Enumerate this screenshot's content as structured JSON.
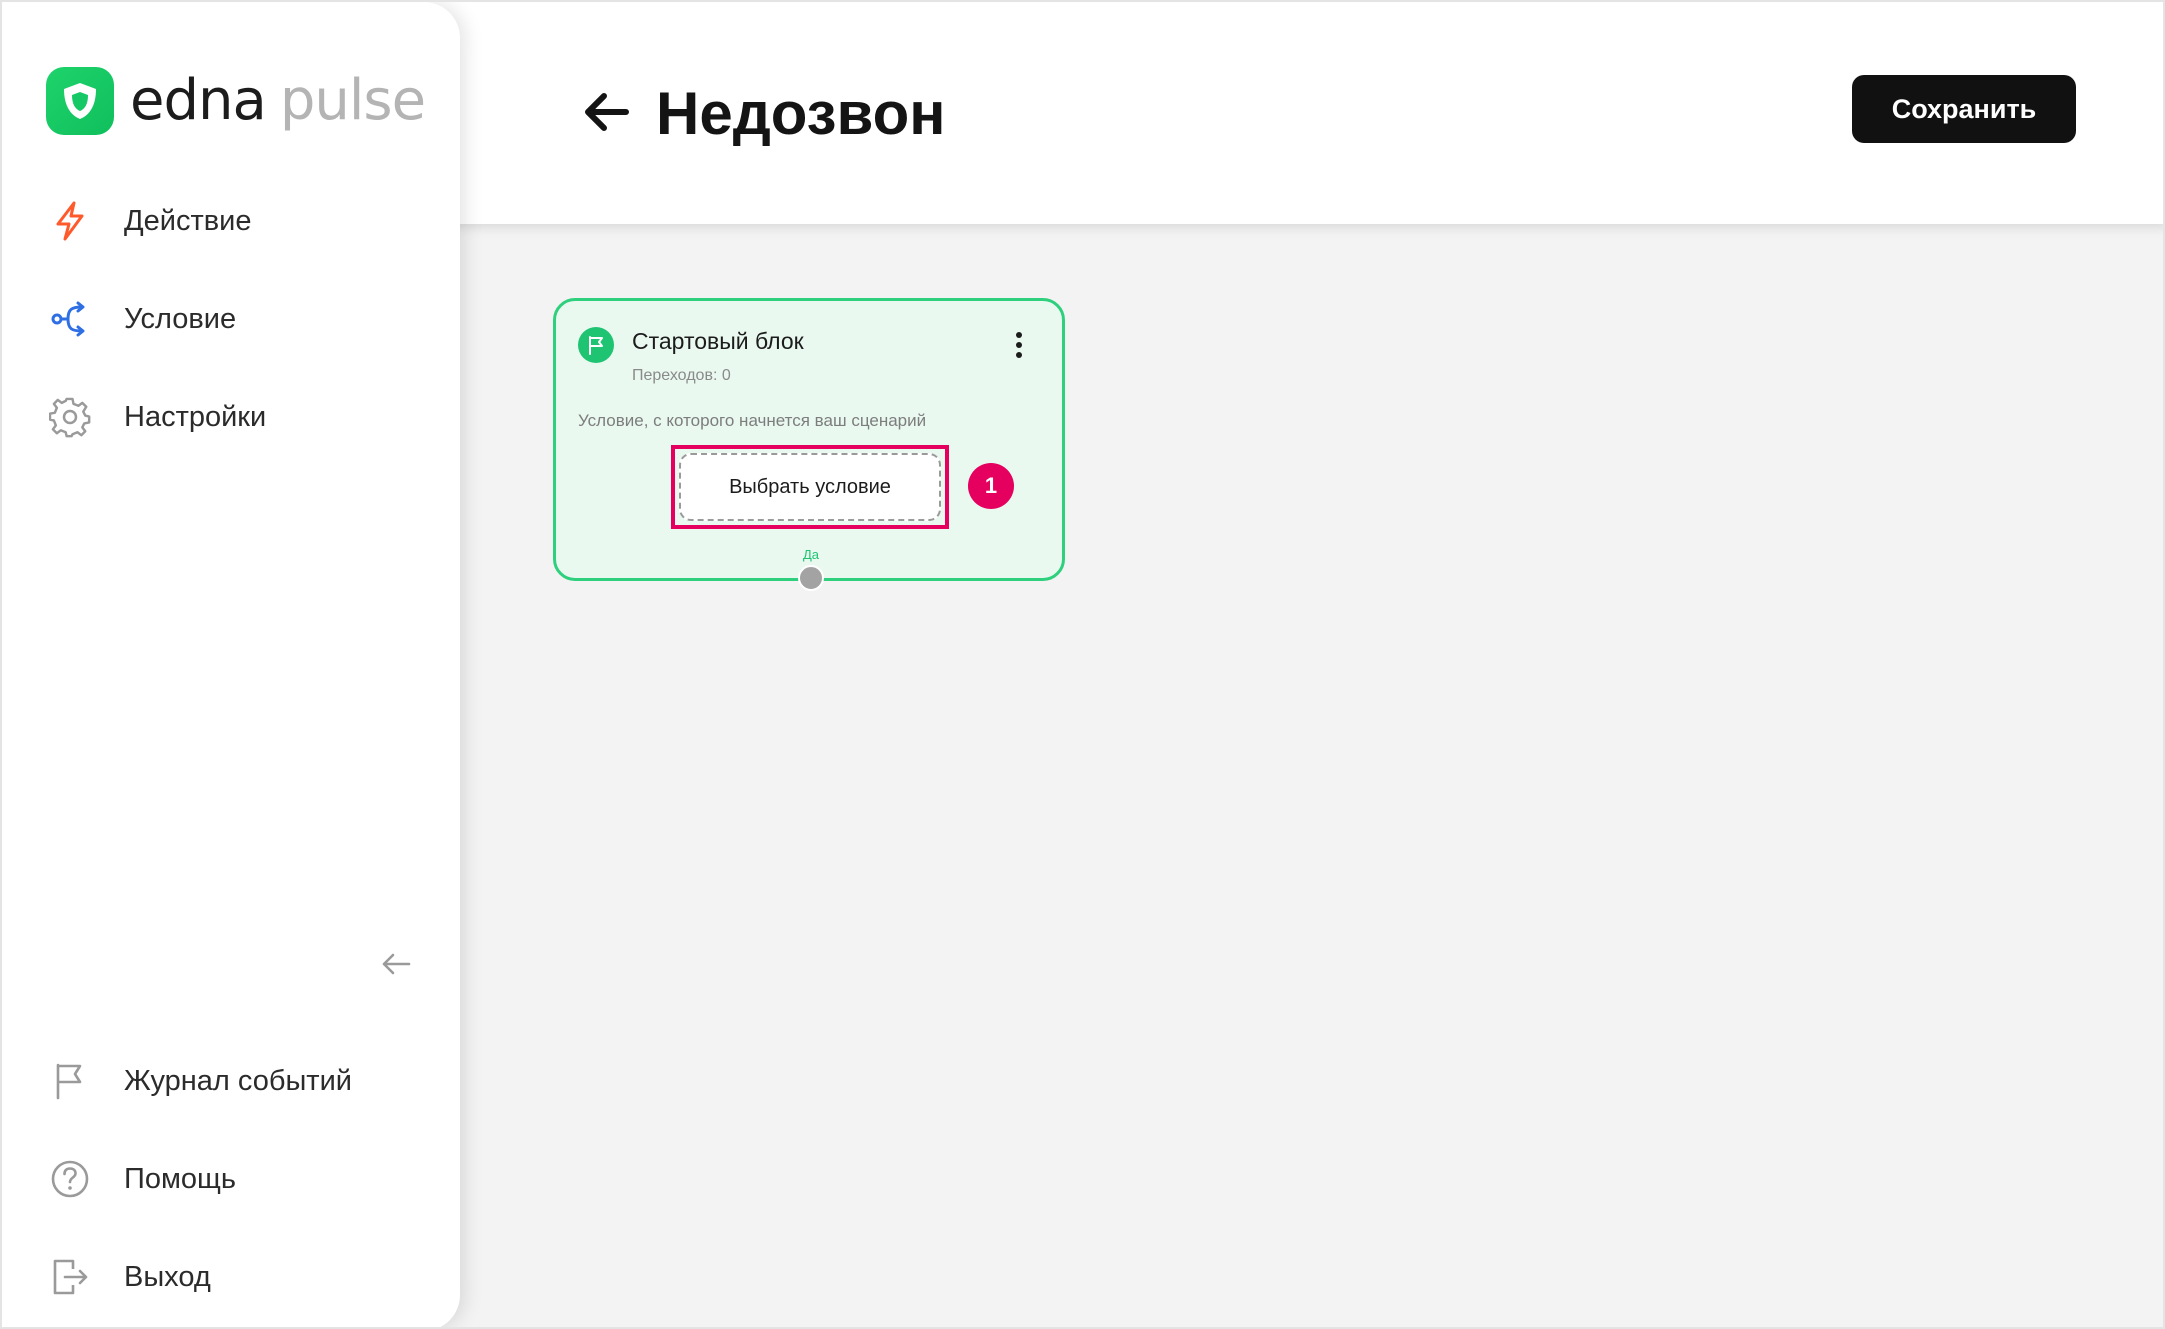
{
  "brand": {
    "part1": "edna",
    "part2": "pulse"
  },
  "sidebar": {
    "top_items": [
      {
        "label": "Действие",
        "icon": "lightning-icon"
      },
      {
        "label": "Условие",
        "icon": "branch-icon"
      },
      {
        "label": "Настройки",
        "icon": "gear-icon"
      }
    ],
    "bottom_items": [
      {
        "label": "Журнал событий",
        "icon": "flag-icon"
      },
      {
        "label": "Помощь",
        "icon": "help-icon"
      },
      {
        "label": "Выход",
        "icon": "logout-icon"
      }
    ]
  },
  "header": {
    "title": "Недозвон",
    "save_label": "Сохранить"
  },
  "block": {
    "title": "Стартовый блок",
    "transitions": "Переходов: 0",
    "description": "Условие, с которого начнется ваш сценарий",
    "choose_label": "Выбрать условие",
    "port_label": "Да"
  },
  "annotation": {
    "badge": "1"
  },
  "colors": {
    "accent_green": "#1fc472",
    "block_bg": "#e9f9f0",
    "highlight": "#e5005f",
    "lightning": "#ff5a2b",
    "branch": "#2f6fe4"
  }
}
